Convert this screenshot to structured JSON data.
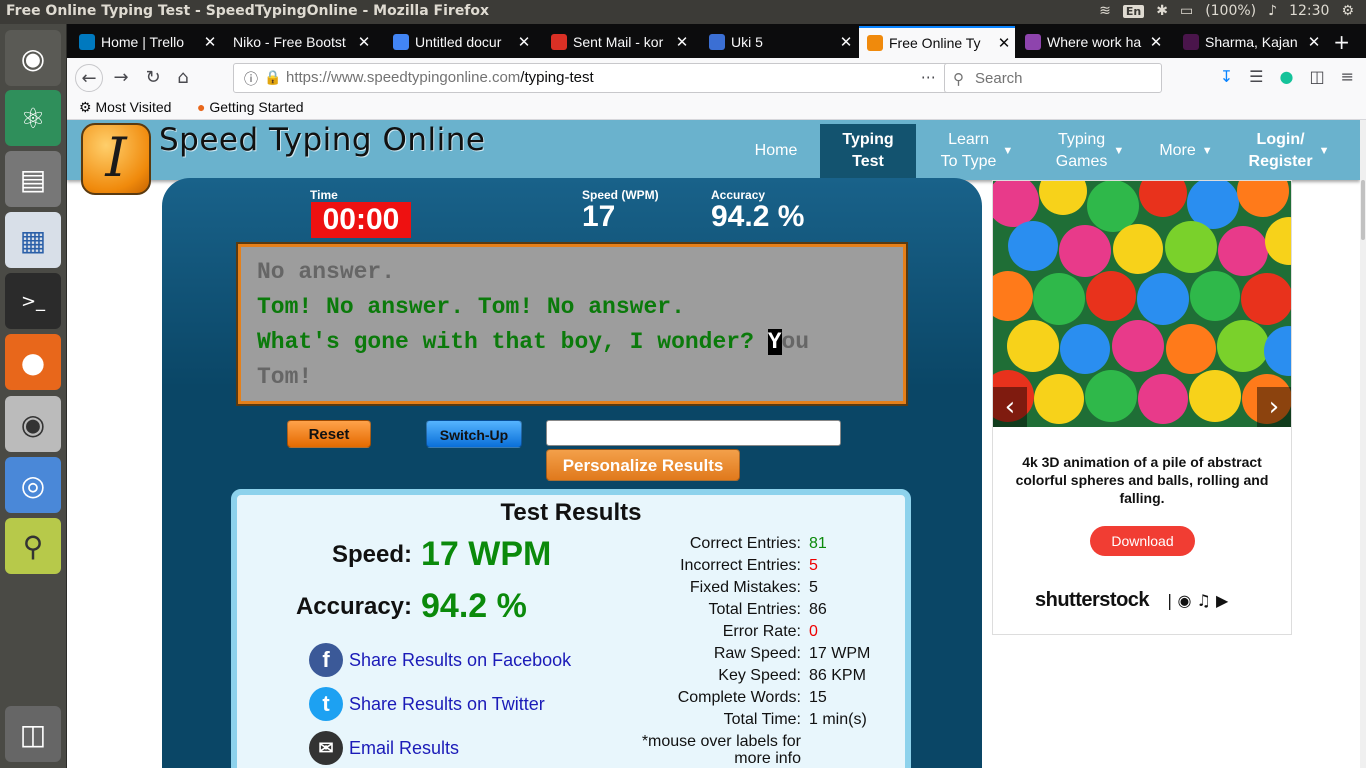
{
  "window": {
    "title": "Free Online Typing Test - SpeedTypingOnline - Mozilla Firefox",
    "battery": "(100%)",
    "clock": "12:30",
    "keyboard": "En"
  },
  "tabs": [
    {
      "label": "Home | Trello",
      "color": "#0079bf"
    },
    {
      "label": "Niko - Free Bootst",
      "color": "#2a2a2a"
    },
    {
      "label": "Untitled docur",
      "color": "#4285f4"
    },
    {
      "label": "Sent Mail - kor",
      "color": "#d93025"
    },
    {
      "label": "Uki 5",
      "color": "#3b6fd4"
    },
    {
      "label": "Free Online Ty",
      "color": "#f08a0c",
      "active": true
    },
    {
      "label": "Where work ha",
      "color": "#8e44ad"
    },
    {
      "label": "Sharma, Kajan",
      "color": "#4a154b"
    }
  ],
  "browser": {
    "url_host": "https://www.speedtypingonline.com",
    "url_path": "/typing-test",
    "search_placeholder": "Search",
    "bookmarks": [
      "Most Visited",
      "Getting Started"
    ]
  },
  "site": {
    "brand": "Speed Typing Online",
    "logo_letter": "I",
    "nav": [
      {
        "label": "Home"
      },
      {
        "label": "Typing\nTest",
        "active": true
      },
      {
        "label": "Learn\nTo Type",
        "dropdown": true
      },
      {
        "label": "Typing\nGames",
        "dropdown": true
      },
      {
        "label": "More",
        "dropdown": true
      },
      {
        "label": "Login/\nRegister",
        "dropdown": true
      }
    ]
  },
  "stats": {
    "time_label": "Time",
    "time_value": "00:00",
    "speed_label": "Speed (WPM)",
    "speed_value": "17",
    "accuracy_label": "Accuracy",
    "accuracy_value": "94.2 %"
  },
  "typing": {
    "line1": "No answer.",
    "line2": "Tom! No answer. Tom! No answer.",
    "line3_typed": "What's gone with that boy, I wonder? ",
    "line3_cursor": "Y",
    "line3_rest": "ou",
    "line4": "Tom!"
  },
  "buttons": {
    "reset": "Reset",
    "switch_up": "Switch-Up",
    "personalize": "Personalize Results"
  },
  "results": {
    "title": "Test Results",
    "speed_label": "Speed:",
    "speed_value": "17 WPM",
    "accuracy_label": "Accuracy:",
    "accuracy_value": "94.2 %",
    "share_facebook": "Share Results on Facebook",
    "share_twitter": "Share Results on Twitter",
    "email": "Email Results",
    "details": [
      {
        "label": "Correct Entries:",
        "value": "81",
        "tone": "green"
      },
      {
        "label": "Incorrect Entries:",
        "value": "5",
        "tone": "red"
      },
      {
        "label": "Fixed Mistakes:",
        "value": "5",
        "tone": ""
      },
      {
        "label": "Total Entries:",
        "value": "86",
        "tone": ""
      },
      {
        "label": "Error Rate:",
        "value": "0",
        "tone": "red"
      },
      {
        "label": "Raw Speed:",
        "value": "17 WPM",
        "tone": ""
      },
      {
        "label": "Key Speed:",
        "value": "86 KPM",
        "tone": ""
      },
      {
        "label": "Complete Words:",
        "value": "15",
        "tone": ""
      },
      {
        "label": "Total Time:",
        "value": "1 min(s)",
        "tone": ""
      }
    ],
    "note_line1": "*mouse over labels for",
    "note_line2": "more info"
  },
  "ad": {
    "description": "4k 3D animation of a pile of abstract colorful spheres and balls, rolling and falling.",
    "download": "Download",
    "brand": "shutterstock"
  }
}
